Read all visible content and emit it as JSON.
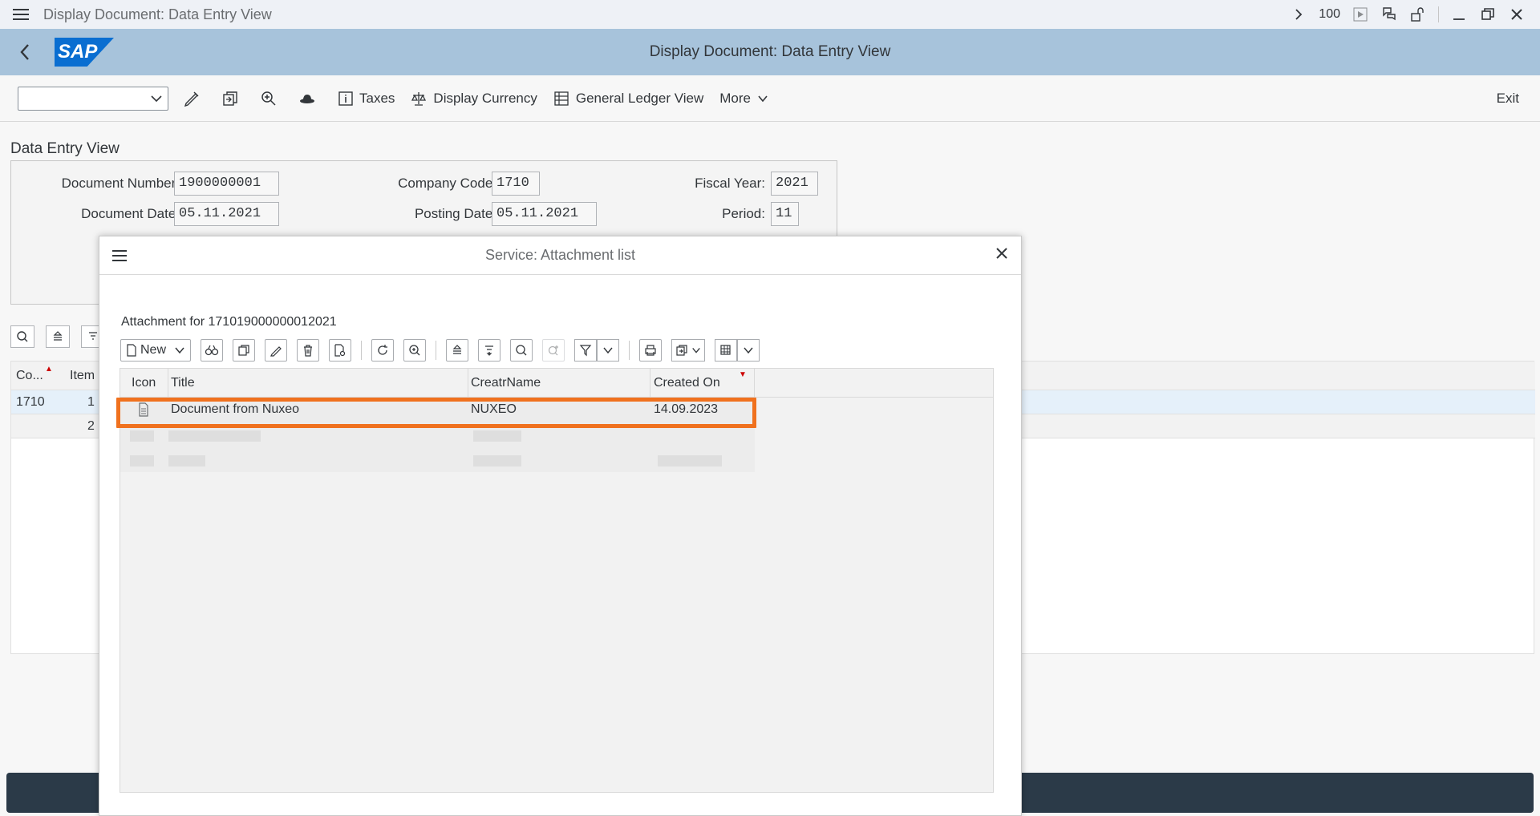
{
  "window": {
    "title": "Display Document: Data Entry View",
    "zoom": "100"
  },
  "shell": {
    "logo": "SAP",
    "title": "Display Document: Data Entry View"
  },
  "toolbar": {
    "taxes": "Taxes",
    "display_currency": "Display Currency",
    "general_ledger_view": "General Ledger View",
    "more": "More",
    "exit": "Exit"
  },
  "section": {
    "title": "Data Entry View",
    "fields": {
      "document_number_label": "Document Number:",
      "document_number": "1900000001",
      "company_code_label": "Company Code:",
      "company_code": "1710",
      "fiscal_year_label": "Fiscal Year:",
      "fiscal_year": "2021",
      "document_date_label": "Document Date:",
      "document_date": "05.11.2021",
      "posting_date_label": "Posting Date:",
      "posting_date": "05.11.2021",
      "period_label": "Period:",
      "period": "11"
    }
  },
  "items_table": {
    "headers": {
      "co": "Co...",
      "item": "Item"
    },
    "rows": [
      {
        "co": "1710",
        "item": "1"
      },
      {
        "co": "",
        "item": "2"
      }
    ]
  },
  "dialog": {
    "title": "Service: Attachment list",
    "attachment_label": "Attachment for 171019000000012021",
    "new_button": "New",
    "columns": {
      "icon": "Icon",
      "title": "Title",
      "creator": "CreatrName",
      "created_on": "Created On"
    },
    "rows": [
      {
        "title": "Document from Nuxeo",
        "creator": "NUXEO",
        "created_on": "14.09.2023"
      }
    ]
  },
  "colors": {
    "shell": "#a7c3db",
    "highlight": "#f0711e",
    "bottom_bar": "#2b3a48",
    "brand": "#0a6ed1"
  }
}
